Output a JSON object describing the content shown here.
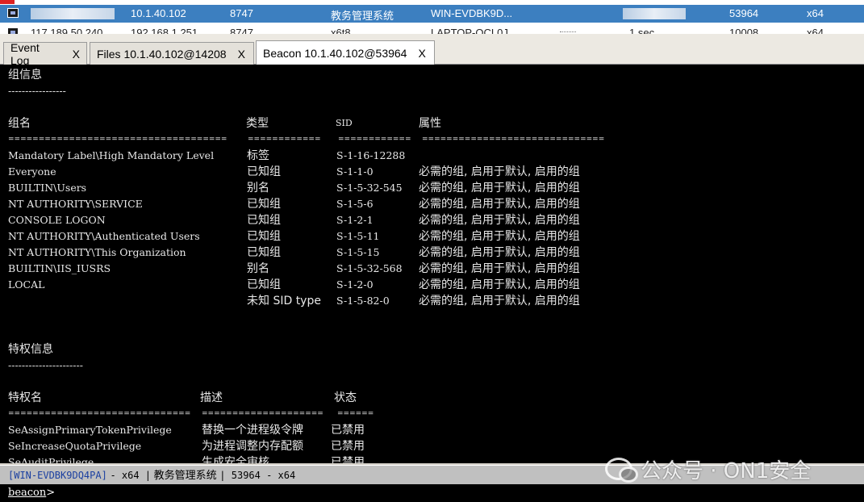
{
  "sessions": [
    {
      "internal": "10.1.40.102",
      "listener": "8747",
      "user": "教务管理系统",
      "computer": "WIN-EVDBK9D...",
      "pid": "53964",
      "arch": "x64"
    },
    {
      "external": "117.189.50.240",
      "internal": "192.168.1.251",
      "listener": "8747",
      "user": "x6t8",
      "computer": "LAPTOP-QCL0J",
      "note": "1 sec",
      "pid": "10008",
      "arch": "x64"
    }
  ],
  "tabs": [
    {
      "label": "Event Log",
      "close": "X"
    },
    {
      "label": "Files 10.1.40.102@14208",
      "close": "X"
    },
    {
      "label": "Beacon 10.1.40.102@53964",
      "close": "X"
    }
  ],
  "console": {
    "group_title": "组信息",
    "group_dashes": "-----------------",
    "group_headers": {
      "name": "组名",
      "type": "类型",
      "sid": "SID",
      "attr": "属性"
    },
    "group_sep": {
      "name": "====================================",
      "type": "============",
      "sid": "============",
      "attr": "=============================="
    },
    "groups": [
      {
        "name": "Mandatory Label\\High Mandatory Level",
        "type": "标签",
        "sid": "S-1-16-12288",
        "attr": ""
      },
      {
        "name": "Everyone",
        "type": "已知组",
        "sid": "S-1-1-0",
        "attr": "必需的组, 启用于默认, 启用的组"
      },
      {
        "name": "BUILTIN\\Users",
        "type": "别名",
        "sid": "S-1-5-32-545",
        "attr": "必需的组, 启用于默认, 启用的组"
      },
      {
        "name": "NT AUTHORITY\\SERVICE",
        "type": "已知组",
        "sid": "S-1-5-6",
        "attr": "必需的组, 启用于默认, 启用的组"
      },
      {
        "name": "CONSOLE LOGON",
        "type": "已知组",
        "sid": "S-1-2-1",
        "attr": "必需的组, 启用于默认, 启用的组"
      },
      {
        "name": "NT AUTHORITY\\Authenticated Users",
        "type": "已知组",
        "sid": "S-1-5-11",
        "attr": "必需的组, 启用于默认, 启用的组"
      },
      {
        "name": "NT AUTHORITY\\This Organization",
        "type": "已知组",
        "sid": "S-1-5-15",
        "attr": "必需的组, 启用于默认, 启用的组"
      },
      {
        "name": "BUILTIN\\IIS_IUSRS",
        "type": "别名",
        "sid": "S-1-5-32-568",
        "attr": "必需的组, 启用于默认, 启用的组"
      },
      {
        "name": "LOCAL",
        "type": "已知组",
        "sid": "S-1-2-0",
        "attr": "必需的组, 启用于默认, 启用的组"
      },
      {
        "name": "",
        "type": "未知 SID type",
        "sid": "S-1-5-82-0",
        "attr": "必需的组, 启用于默认, 启用的组"
      }
    ],
    "priv_title": "特权信息",
    "priv_dashes": "----------------------",
    "priv_headers": {
      "name": "特权名",
      "desc": "描述",
      "state": "状态"
    },
    "priv_sep": {
      "name": "==============================",
      "desc": "====================",
      "state": "======"
    },
    "privs": [
      {
        "name": "SeAssignPrimaryTokenPrivilege",
        "desc": "替换一个进程级令牌",
        "state": "已禁用"
      },
      {
        "name": "SeIncreaseQuotaPrivilege",
        "desc": "为进程调整内存配额",
        "state": "已禁用"
      },
      {
        "name": "SeAuditPrivilege",
        "desc": "生成安全审核",
        "state": "已禁用"
      }
    ]
  },
  "status": {
    "host": "[WIN-EVDBK9DQ4PA]",
    "arch1": "- x64 |",
    "user": "教务管理系统",
    "pid_arch": "| 53964 - x64"
  },
  "input": {
    "prompt": "beacon",
    "suffix": ">",
    "value": ""
  },
  "watermark": {
    "text": "公众号 · ON1安全"
  }
}
